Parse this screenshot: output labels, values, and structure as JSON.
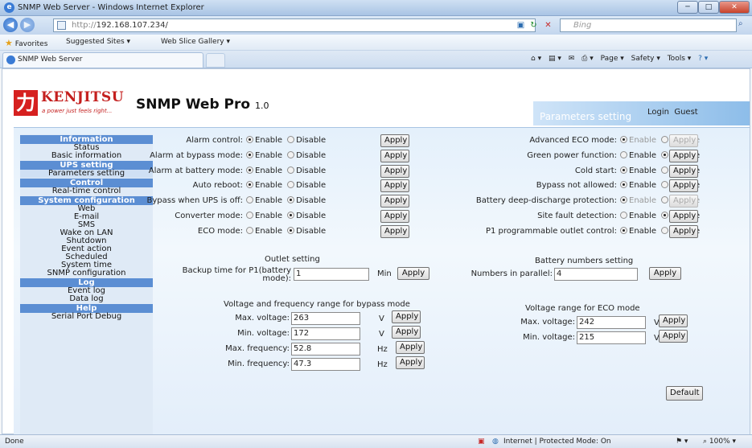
{
  "window": {
    "title": "SNMP Web Server - Windows Internet Explorer"
  },
  "address": {
    "url_prefix": "http://",
    "url_host": "192.168.107.234/",
    "search_placeholder": "Bing"
  },
  "favorites": {
    "label": "Favorites",
    "suggested": "Suggested Sites ▾",
    "slice": "Web Slice Gallery ▾"
  },
  "tabs": {
    "active": "SNMP Web Server"
  },
  "commands": {
    "page": "Page ▾",
    "safety": "Safety ▾",
    "tools": "Tools ▾"
  },
  "header": {
    "brand": "KENJITSU",
    "tagline": "a power just feels right...",
    "logo_char": "力",
    "app_title": "SNMP Web Pro",
    "version": "1.0",
    "section_title": "Parameters setting",
    "login_label": "Login",
    "login_user": "Guest"
  },
  "sidebar": [
    {
      "section": "Information",
      "items": [
        "Status",
        "Basic information"
      ]
    },
    {
      "section": "UPS setting",
      "items": [
        "Parameters setting"
      ]
    },
    {
      "section": "Control",
      "items": [
        "Real-time control"
      ]
    },
    {
      "section": "System configuration",
      "items": [
        "Web",
        "E-mail",
        "SMS",
        "Wake on LAN",
        "Shutdown",
        "Event action",
        "Scheduled",
        "System time",
        "SNMP configuration"
      ]
    },
    {
      "section": "Log",
      "items": [
        "Event log",
        "Data log"
      ]
    },
    {
      "section": "Help",
      "items": [
        "Serial Port Debug"
      ]
    }
  ],
  "radio": {
    "enable": "Enable",
    "disable": "Disable",
    "apply": "Apply"
  },
  "params_left": [
    {
      "label": "Alarm control:",
      "value": "enable"
    },
    {
      "label": "Alarm at bypass mode:",
      "value": "enable"
    },
    {
      "label": "Alarm at battery mode:",
      "value": "enable"
    },
    {
      "label": "Auto reboot:",
      "value": "enable"
    },
    {
      "label": "Bypass when UPS is off:",
      "value": "disable"
    },
    {
      "label": "Converter mode:",
      "value": "disable"
    },
    {
      "label": "ECO mode:",
      "value": "disable"
    }
  ],
  "params_right": [
    {
      "label": "Advanced ECO mode:",
      "value": "enable",
      "disabled": true
    },
    {
      "label": "Green power function:",
      "value": "disable"
    },
    {
      "label": "Cold start:",
      "value": "enable"
    },
    {
      "label": "Bypass not allowed:",
      "value": "enable"
    },
    {
      "label": "Battery deep-discharge protection:",
      "value": "enable",
      "disabled": true
    },
    {
      "label": "Site fault detection:",
      "value": "disable"
    },
    {
      "label": "P1 programmable outlet control:",
      "value": "enable"
    }
  ],
  "outlet": {
    "title": "Outlet setting",
    "label_line1": "Backup time for P1(battery",
    "label_line2": "mode):",
    "value": "1",
    "unit": "Min",
    "apply": "Apply"
  },
  "battery": {
    "title": "Battery numbers setting",
    "label": "Numbers in parallel:",
    "value": "4",
    "apply": "Apply"
  },
  "bypass_range": {
    "title": "Voltage and frequency range for bypass mode",
    "rows": [
      {
        "label": "Max. voltage:",
        "value": "263",
        "unit": "V"
      },
      {
        "label": "Min. voltage:",
        "value": "172",
        "unit": "V"
      },
      {
        "label": "Max. frequency:",
        "value": "52.8",
        "unit": "Hz"
      },
      {
        "label": "Min. frequency:",
        "value": "47.3",
        "unit": "Hz"
      }
    ]
  },
  "eco_range": {
    "title": "Voltage range for ECO mode",
    "rows": [
      {
        "label": "Max. voltage:",
        "value": "242",
        "unit": "V"
      },
      {
        "label": "Min. voltage:",
        "value": "215",
        "unit": "V"
      }
    ]
  },
  "default_button": "Default",
  "status": {
    "left": "Done",
    "zone": "Internet | Protected Mode: On",
    "zoom": "100%"
  }
}
